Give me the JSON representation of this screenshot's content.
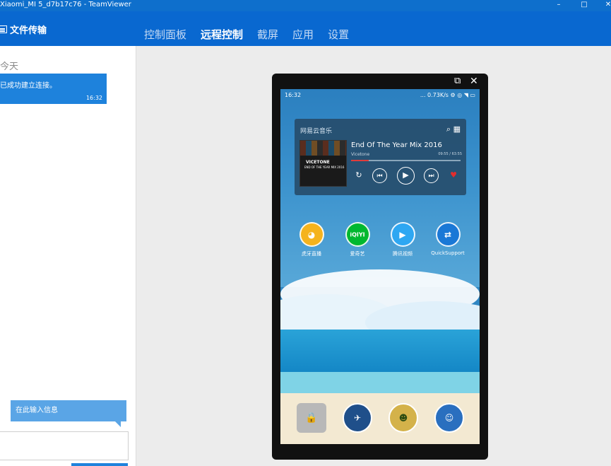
{
  "window": {
    "title": "Xiaomi_MI 5_d7b17c76 - TeamViewer"
  },
  "nav": {
    "file_transfer": "文件传输",
    "tabs": [
      {
        "label": "控制面板"
      },
      {
        "label": "远程控制"
      },
      {
        "label": "截屏"
      },
      {
        "label": "应用"
      },
      {
        "label": "设置"
      }
    ]
  },
  "chat": {
    "day": "今天",
    "message": "已成功建立连接。",
    "message_time": "16:32",
    "input_hint": "在此输入信息"
  },
  "phone": {
    "status_time": "16:32",
    "status_right": "... 0.73K/s",
    "music_widget": {
      "app_name": "网易云音乐",
      "cover_line1": "VICETONE",
      "cover_line2": "END OF THE YEAR MIX 2016",
      "title": "End Of The Year Mix 2016",
      "artist": "Vicetone",
      "time": "09:55 / 63:55",
      "progress": 0.16
    },
    "apps": [
      {
        "label": "虎牙直播",
        "color": "#f5b31d"
      },
      {
        "label": "爱奇艺",
        "color": "#00b82f"
      },
      {
        "label": "腾讯视频",
        "color": "#2ea7f2"
      },
      {
        "label": "QuickSupport",
        "color": "#1a78d6"
      }
    ]
  },
  "colors": {
    "titlebar": "#0e6fcc",
    "navbar": "#0968d0",
    "bubble": "#1e82dc",
    "hint": "#5aa5e6"
  }
}
